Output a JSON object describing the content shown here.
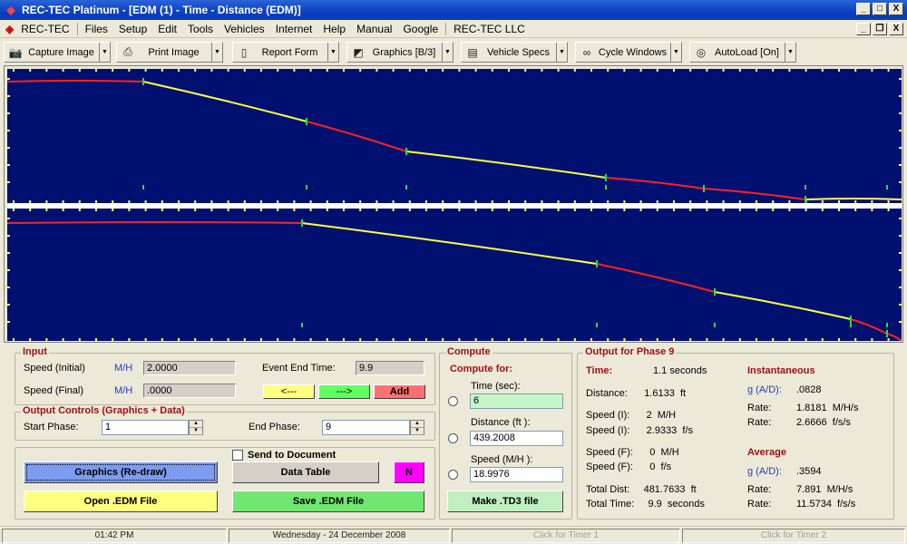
{
  "window": {
    "title": "REC-TEC Platinum - [EDM (1) - Time - Distance (EDM)]",
    "minimize": "_",
    "maximize": "□",
    "close": "X",
    "mdi_minimize": "_",
    "mdi_restore": "❐",
    "mdi_close": "X"
  },
  "menu": {
    "app_label": "REC-TEC",
    "items": [
      "Files",
      "Setup",
      "Edit",
      "Tools",
      "Vehicles",
      "Internet",
      "Help",
      "Manual",
      "Google"
    ],
    "company": "REC-TEC LLC"
  },
  "toolbar": {
    "buttons": [
      {
        "label": "Capture Image",
        "icon": "camera-icon"
      },
      {
        "label": "Print Image",
        "icon": "printer-icon"
      },
      {
        "label": "Report Form",
        "icon": "document-icon"
      },
      {
        "label": "Graphics [B/3]",
        "icon": "graphics-icon"
      },
      {
        "label": "Vehicle Specs",
        "icon": "clipboard-icon"
      },
      {
        "label": "Cycle Windows",
        "icon": "binoculars-icon"
      },
      {
        "label": "AutoLoad [On]",
        "icon": "globe-icon"
      }
    ]
  },
  "colors": {
    "plot_bg": "#001070",
    "segment_red": "#ff2020",
    "segment_yellow": "#ffff40",
    "marker_green": "#20e040",
    "tick_yellow": "#ffff60"
  },
  "input": {
    "title": "Input",
    "speed_initial_label": "Speed (Initial)",
    "speed_initial_unit": "M/H",
    "speed_initial_value": "2.0000",
    "speed_final_label": "Speed (Final)",
    "speed_final_unit": "M/H",
    "speed_final_value": ".0000",
    "event_end_label": "Event End Time:",
    "event_end_value": "9.9",
    "prev_button": "<---",
    "next_button": "--->",
    "add_button": "Add"
  },
  "output_controls": {
    "title": "Output Controls (Graphics + Data)",
    "start_phase_label": "Start Phase:",
    "start_phase_value": "1",
    "end_phase_label": "End Phase:",
    "end_phase_value": "9"
  },
  "actions": {
    "send_to_document": "Send to Document",
    "graphics_redraw": "Graphics (Re-draw)",
    "data_table": "Data Table",
    "n_button": "N",
    "open_file": "Open .EDM File",
    "save_file": "Save .EDM File"
  },
  "compute": {
    "title": "Compute",
    "compute_for": "Compute for:",
    "time_label": "Time (sec):",
    "time_value": "6",
    "distance_label": "Distance (ft ):",
    "distance_value": "439.2008",
    "speed_label": "Speed (M/H ):",
    "speed_value": "18.9976",
    "make_td3": "Make .TD3 file"
  },
  "output": {
    "title": "Output for Phase 9",
    "time_label": "Time:",
    "time_value": "1.1  seconds",
    "distance": "Distance:      1.6133  ft",
    "speed_i_mh": "Speed (I):      2  M/H",
    "speed_i_fs": "Speed (I):      2.9333  f/s",
    "speed_f_mh": "Speed (F):      0  M/H",
    "speed_f_fs": "Speed (F):      0  f/s",
    "total_dist": "Total Dist:     481.7633  ft",
    "total_time": "Total Time:     9.9  seconds",
    "instantaneous_title": "Instantaneous",
    "inst_g_label": "g (A/D):",
    "inst_g_value": ".0828",
    "inst_rate1_label": "Rate:",
    "inst_rate1_value": "1.8181  M/H/s",
    "inst_rate2_label": "Rate:",
    "inst_rate2_value": "2.6666  f/s/s",
    "average_title": "Average",
    "avg_g_label": "g (A/D):",
    "avg_g_value": ".3594",
    "avg_rate1_label": "Rate:",
    "avg_rate1_value": "7.891  M/H/s",
    "avg_rate2_label": "Rate:",
    "avg_rate2_value": "11.5734  f/s/s"
  },
  "status": {
    "time": "01:42 PM",
    "date": "Wednesday  -  24 December 2008",
    "timer1": "Click for Timer 1",
    "timer2": "Click for Timer 2"
  }
}
